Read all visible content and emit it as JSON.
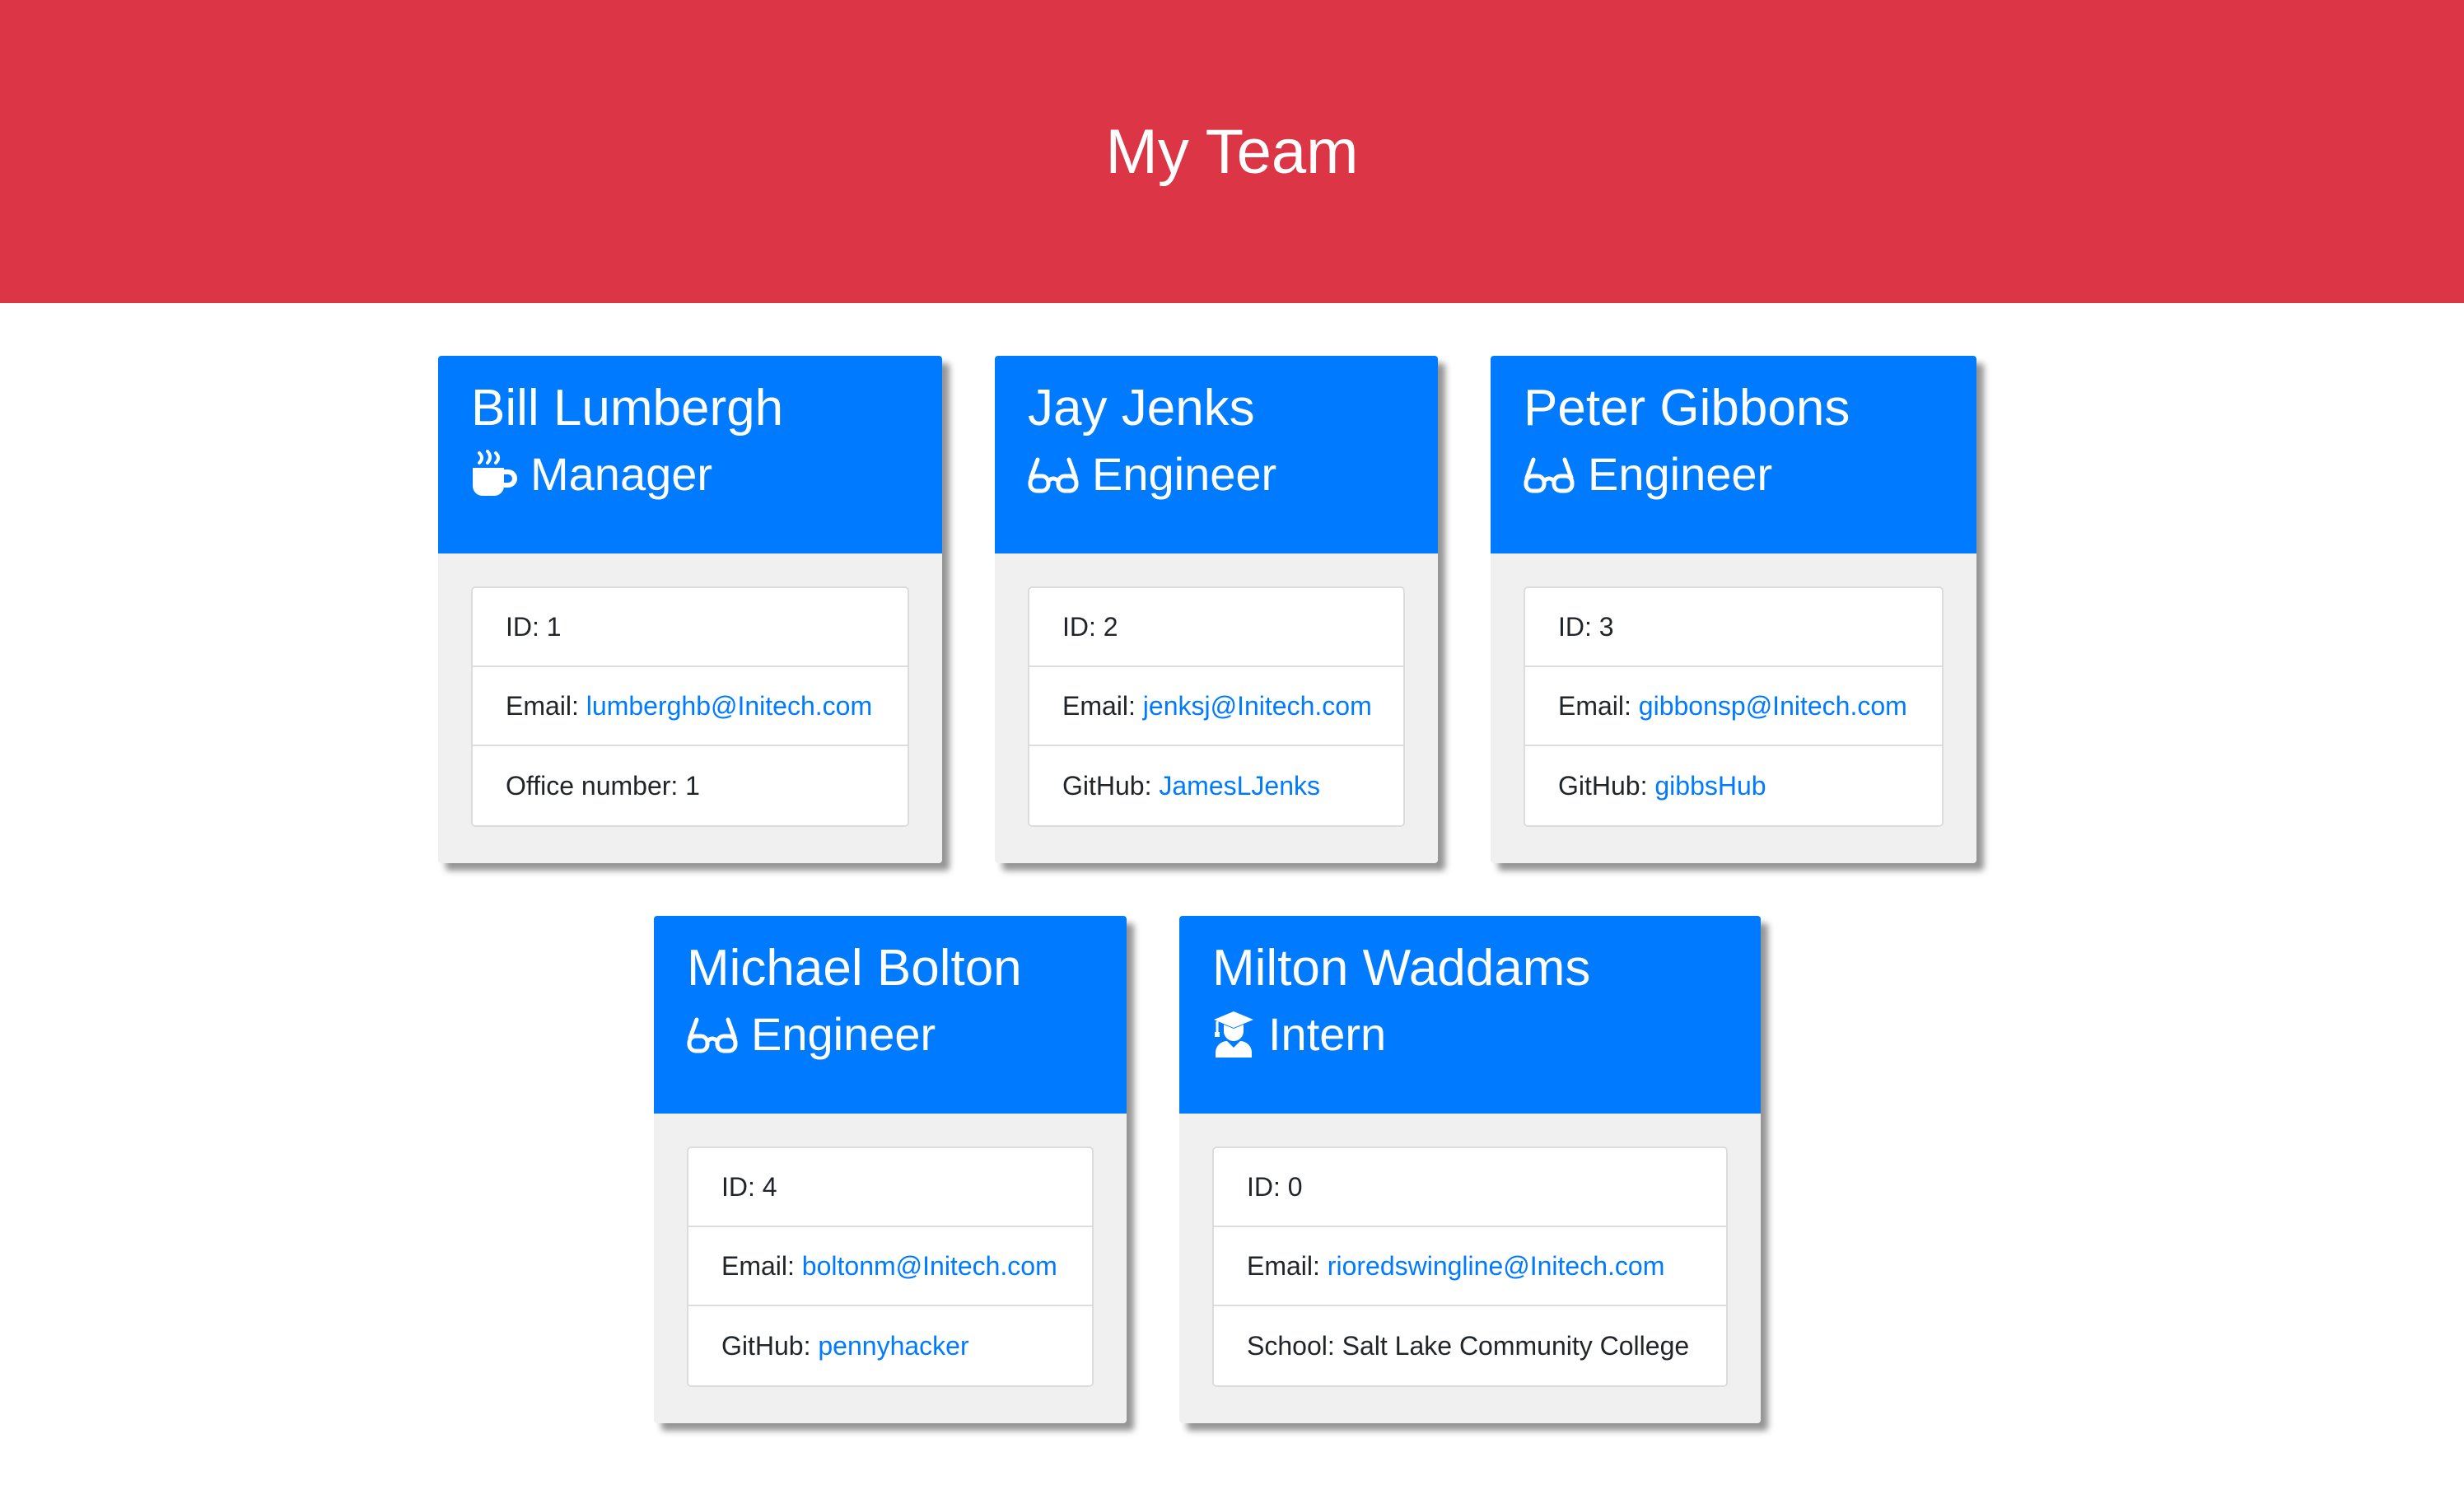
{
  "header": {
    "title": "My Team"
  },
  "colors": {
    "header_bg": "#dc3545",
    "card_header_bg": "#007bff",
    "link": "#007bff",
    "card_body_bg": "#f0f0f0"
  },
  "team": [
    {
      "name": "Bill Lumbergh",
      "role": "Manager",
      "icon": "mug-icon",
      "id_label": "ID: 1",
      "email_label": "Email:",
      "email": "lumberghb@Initech.com",
      "extra_label": "Office number: 1",
      "extra_link": ""
    },
    {
      "name": "Jay Jenks",
      "role": "Engineer",
      "icon": "glasses-icon",
      "id_label": "ID: 2",
      "email_label": "Email:",
      "email": "jenksj@Initech.com",
      "extra_label": "GitHub:",
      "extra_link": "JamesLJenks"
    },
    {
      "name": "Peter Gibbons",
      "role": "Engineer",
      "icon": "glasses-icon",
      "id_label": "ID: 3",
      "email_label": "Email:",
      "email": "gibbonsp@Initech.com",
      "extra_label": "GitHub:",
      "extra_link": "gibbsHub"
    },
    {
      "name": "Michael Bolton",
      "role": "Engineer",
      "icon": "glasses-icon",
      "id_label": "ID: 4",
      "email_label": "Email:",
      "email": "boltonm@Initech.com",
      "extra_label": "GitHub:",
      "extra_link": "pennyhacker"
    },
    {
      "name": "Milton Waddams",
      "role": "Intern",
      "icon": "graduate-icon",
      "id_label": "ID: 0",
      "email_label": "Email:",
      "email": "rioredswingline@Initech.com",
      "extra_label": "School: Salt Lake Community College",
      "extra_link": ""
    }
  ]
}
